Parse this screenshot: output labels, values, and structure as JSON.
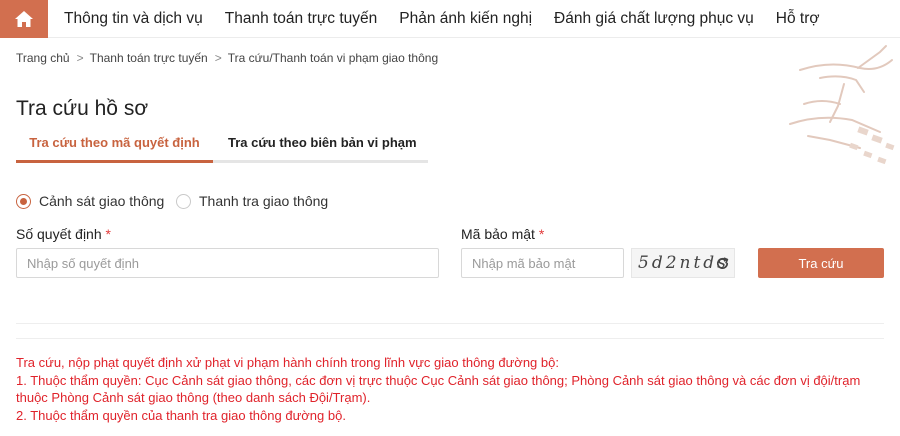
{
  "nav": {
    "items": [
      "Thông tin và dịch vụ",
      "Thanh toán trực tuyến",
      "Phản ánh kiến nghị",
      "Đánh giá chất lượng phục vụ",
      "Hỗ trợ"
    ]
  },
  "breadcrumb": {
    "items": [
      "Trang chủ",
      "Thanh toán trực tuyến",
      "Tra cứu/Thanh toán vi phạm giao thông"
    ],
    "separator": ">"
  },
  "page": {
    "title": "Tra cứu hồ sơ"
  },
  "tabs": {
    "items": [
      "Tra cứu theo mã quyết định",
      "Tra cứu theo biên bản vi phạm"
    ],
    "active": "Tra cứu theo mã quyết định"
  },
  "radios": {
    "items": [
      "Cảnh sát giao thông",
      "Thanh tra giao thông"
    ],
    "selected": "Cảnh sát giao thông"
  },
  "form": {
    "decision_label": "Số quyết định",
    "decision_placeholder": "Nhập số quyết định",
    "security_label": "Mã bảo mật",
    "security_placeholder": "Nhập mã bảo mật",
    "required_mark": "*",
    "captcha_text": "5d2ntds",
    "submit_label": "Tra cứu"
  },
  "notes": {
    "lines": [
      "Tra cứu, nộp phạt quyết định xử phạt vi phạm hành chính trong lĩnh vực giao thông đường bộ:",
      "1. Thuộc thẩm quyền: Cục Cảnh sát giao thông, các đơn vị trực thuộc Cục Cảnh sát giao thông; Phòng Cảnh sát giao thông và các đơn vị đội/trạm thuộc Phòng Cảnh sát giao thông (theo danh sách Đội/Trạm).",
      "2. Thuộc thẩm quyền của thanh tra giao thông đường bộ."
    ]
  },
  "colors": {
    "accent": "#d26f4f",
    "active_tab": "#c8633f",
    "note_text": "#e0232b"
  },
  "icons": {
    "home": "home-icon",
    "refresh": "refresh-icon",
    "motif": "decorative-crane-motif"
  }
}
